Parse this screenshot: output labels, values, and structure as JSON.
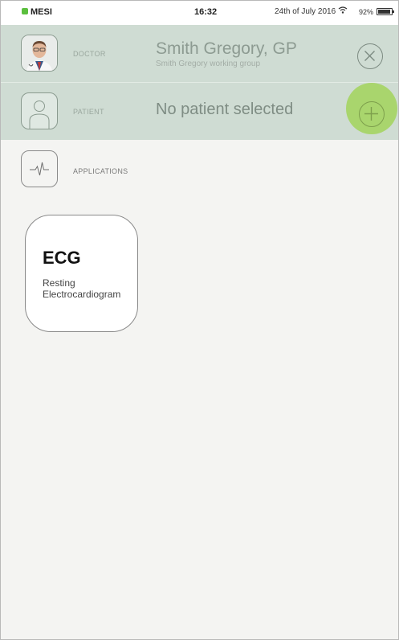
{
  "status_bar": {
    "carrier": "MESI",
    "time": "16:32",
    "date": "24th of July 2016",
    "battery": "92%"
  },
  "doctor": {
    "label": "DOCTOR",
    "name": "Smith Gregory, GP",
    "group": "Smith Gregory working group"
  },
  "patient": {
    "label": "PATIENT",
    "status": "No patient selected"
  },
  "applications": {
    "label": "APPLICATIONS",
    "items": [
      {
        "title": "ECG",
        "desc_line1": "Resting",
        "desc_line2": "Electrocardiogram"
      }
    ]
  },
  "colors": {
    "header_row": "#cfdcd3",
    "add_button": "#a9d56d",
    "background": "#f4f4f2"
  }
}
